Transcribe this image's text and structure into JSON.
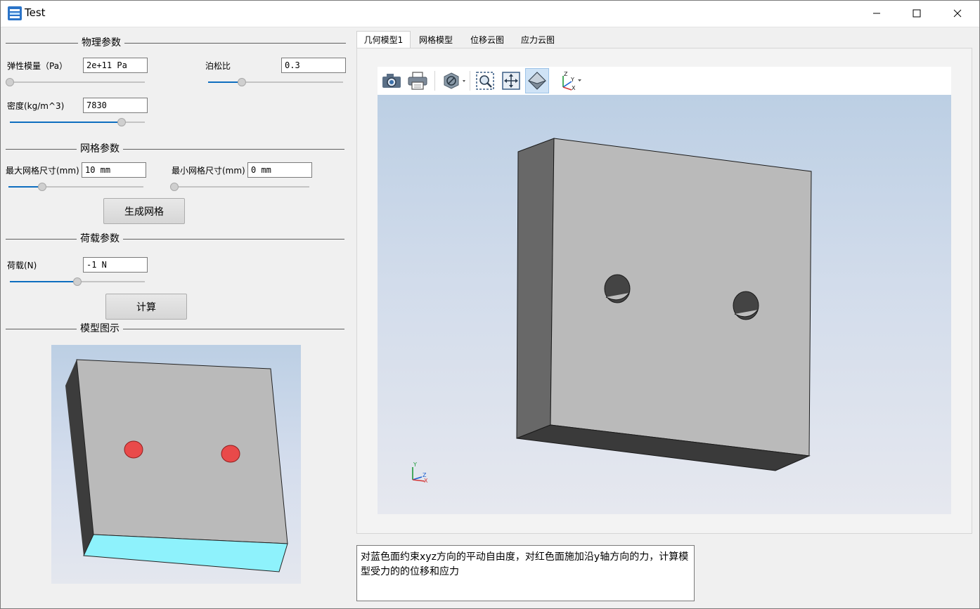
{
  "window": {
    "title": "Test",
    "controls": {
      "minimize": "—",
      "maximize": "☐",
      "close": "✕"
    }
  },
  "physics": {
    "group_title": "物理参数",
    "elastic_label": "弹性模量（Pa）",
    "elastic_value": "2e+11 Pa",
    "elastic_slider": 0.0,
    "poisson_label": "泊松比",
    "poisson_value": "0.3",
    "poisson_slider": 0.25,
    "density_label": "密度(kg/m^3)",
    "density_value": "7830",
    "density_slider": 0.83
  },
  "mesh": {
    "group_title": "网格参数",
    "max_label": "最大网格尺寸(mm)",
    "max_value": "10 mm",
    "max_slider": 0.25,
    "min_label": "最小网格尺寸(mm)",
    "min_value": "0 mm",
    "min_slider": 0.0,
    "generate_button": "生成网格"
  },
  "load": {
    "group_title": "荷载参数",
    "load_label": "荷载(N)",
    "load_value": "-1 N",
    "load_slider": 0.5,
    "compute_button": "计算"
  },
  "model_preview": {
    "group_title": "模型图示"
  },
  "tabs": [
    "几何模型1",
    "网格模型",
    "位移云图",
    "应力云图"
  ],
  "toolbar": {
    "icons": [
      "camera-icon",
      "printer-icon",
      "display-mode-icon",
      "zoom-box-icon",
      "fit-all-icon",
      "view-iso-icon",
      "axis-view-icon"
    ]
  },
  "viewer": {
    "triad_labels": {
      "y": "Y",
      "z": "Z",
      "x": "X"
    },
    "toolbar_axis_labels": {
      "z": "Z",
      "y": "Y",
      "x": "X"
    }
  },
  "description": "对蓝色面约束xyz方向的平动自由度，对红色面施加沿y轴方向的力，计算模型受力的的位移和应力",
  "colors": {
    "plate_front": "#bababa",
    "plate_side": "#686868",
    "plate_bottom": "#3a3a3a",
    "fixed_face": "#8ef2fc",
    "load_holes": "#e94a4a",
    "slider_fill": "#0e6ebf"
  }
}
